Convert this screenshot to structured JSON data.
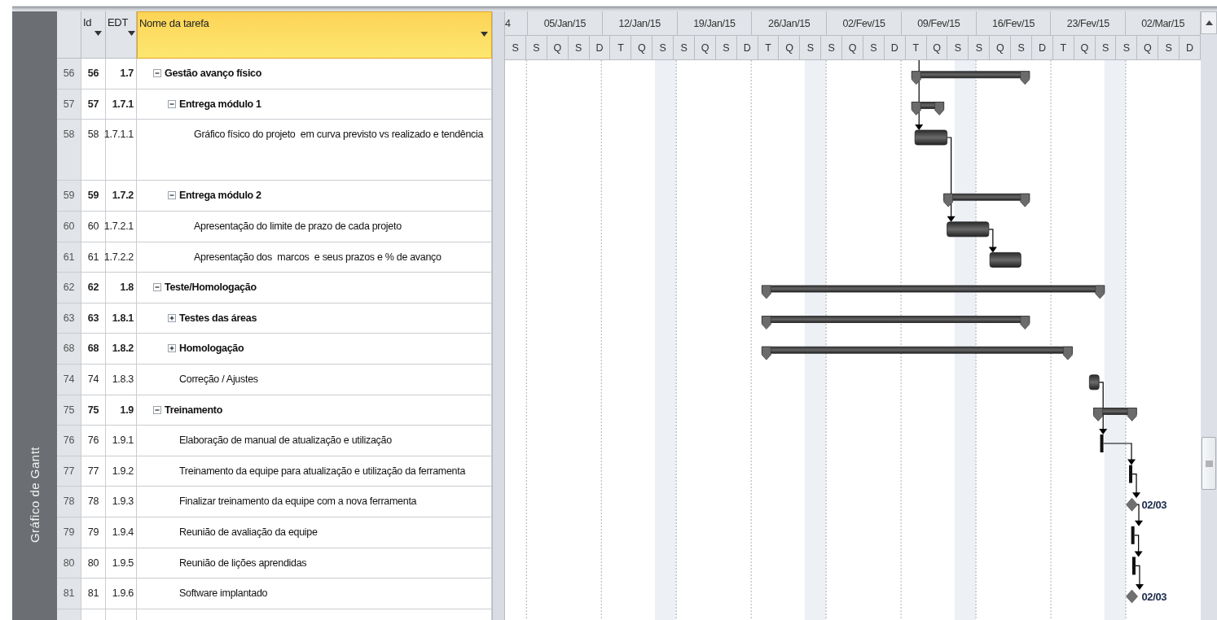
{
  "view_label": "Gráfico de Gantt",
  "columns": [
    {
      "label": "Id",
      "selected": false
    },
    {
      "label": "EDT",
      "selected": false
    },
    {
      "label": "Nome da tarefa",
      "selected": true
    }
  ],
  "timescale": {
    "weeks": [
      "4",
      "05/Jan/15",
      "12/Jan/15",
      "19/Jan/15",
      "26/Jan/15",
      "02/Fev/15",
      "09/Fev/15",
      "16/Fev/15",
      "23/Fev/15",
      "02/Mar/15"
    ],
    "days": [
      "S",
      "S",
      "Q",
      "S",
      "D",
      "T",
      "Q",
      "S",
      "S",
      "Q",
      "S",
      "D",
      "T",
      "Q",
      "S",
      "S",
      "Q",
      "S",
      "D",
      "T",
      "Q",
      "S",
      "S",
      "Q",
      "S",
      "D",
      "T",
      "Q",
      "S",
      "S",
      "Q",
      "S",
      "D"
    ]
  },
  "tasks": [
    {
      "row": "56",
      "id": "56",
      "wbs": "1.7",
      "name": "Gestão avanço físico",
      "expanded": true,
      "bar": {
        "kind": "summary"
      },
      "children": [
        {
          "row": "57",
          "id": "57",
          "wbs": "1.7.1",
          "name": "Entrega módulo 1",
          "expanded": true,
          "bar": {
            "kind": "summary"
          },
          "children": [
            {
              "row": "58",
              "id": "58",
              "wbs": "1.7.1.1",
              "name": "Gráfico físico do projeto  em curva previsto vs realizado e tendência",
              "tall": true,
              "bar": {
                "kind": "task"
              }
            }
          ]
        },
        {
          "row": "59",
          "id": "59",
          "wbs": "1.7.2",
          "name": "Entrega módulo 2",
          "expanded": true,
          "bar": {
            "kind": "summary"
          },
          "children": [
            {
              "row": "60",
              "id": "60",
              "wbs": "1.7.2.1",
              "name": "Apresentação do limite de prazo de cada projeto",
              "bar": {
                "kind": "task"
              }
            },
            {
              "row": "61",
              "id": "61",
              "wbs": "1.7.2.2",
              "name": "Apresentação dos  marcos  e seus prazos e % de avanço",
              "bar": {
                "kind": "task"
              }
            }
          ]
        }
      ]
    },
    {
      "row": "62",
      "id": "62",
      "wbs": "1.8",
      "name": "Teste/Homologação",
      "expanded": true,
      "bar": {
        "kind": "summary"
      },
      "children": [
        {
          "row": "63",
          "id": "63",
          "wbs": "1.8.1",
          "name": "Testes das áreas",
          "expanded": false,
          "bar": {
            "kind": "summary"
          }
        },
        {
          "row": "68",
          "id": "68",
          "wbs": "1.8.2",
          "name": "Homologação",
          "expanded": false,
          "bar": {
            "kind": "summary"
          }
        },
        {
          "row": "74",
          "id": "74",
          "wbs": "1.8.3",
          "name": "Correção / Ajustes",
          "bar": {
            "kind": "task"
          }
        }
      ]
    },
    {
      "row": "75",
      "id": "75",
      "wbs": "1.9",
      "name": "Treinamento",
      "expanded": true,
      "bar": {
        "kind": "summary"
      },
      "children": [
        {
          "row": "76",
          "id": "76",
          "wbs": "1.9.1",
          "name": "Elaboração de manual de atualização e utilização",
          "bar": {
            "kind": "short"
          }
        },
        {
          "row": "77",
          "id": "77",
          "wbs": "1.9.2",
          "name": "Treinamento da equipe para atualização e utilização da ferramenta",
          "bar": {
            "kind": "short"
          }
        },
        {
          "row": "78",
          "id": "78",
          "wbs": "1.9.3",
          "name": "Finalizar treinamento da equipe com a nova ferramenta",
          "bar": {
            "kind": "milestone",
            "label": "02/03"
          }
        },
        {
          "row": "79",
          "id": "79",
          "wbs": "1.9.4",
          "name": "Reunião de avaliação da equipe",
          "bar": {
            "kind": "short"
          }
        },
        {
          "row": "80",
          "id": "80",
          "wbs": "1.9.5",
          "name": "Reunião de lições aprendidas",
          "bar": {
            "kind": "short"
          }
        },
        {
          "row": "81",
          "id": "81",
          "wbs": "1.9.6",
          "name": "Software implantado",
          "bar": {
            "kind": "milestone",
            "label": "02/03"
          }
        }
      ]
    }
  ]
}
